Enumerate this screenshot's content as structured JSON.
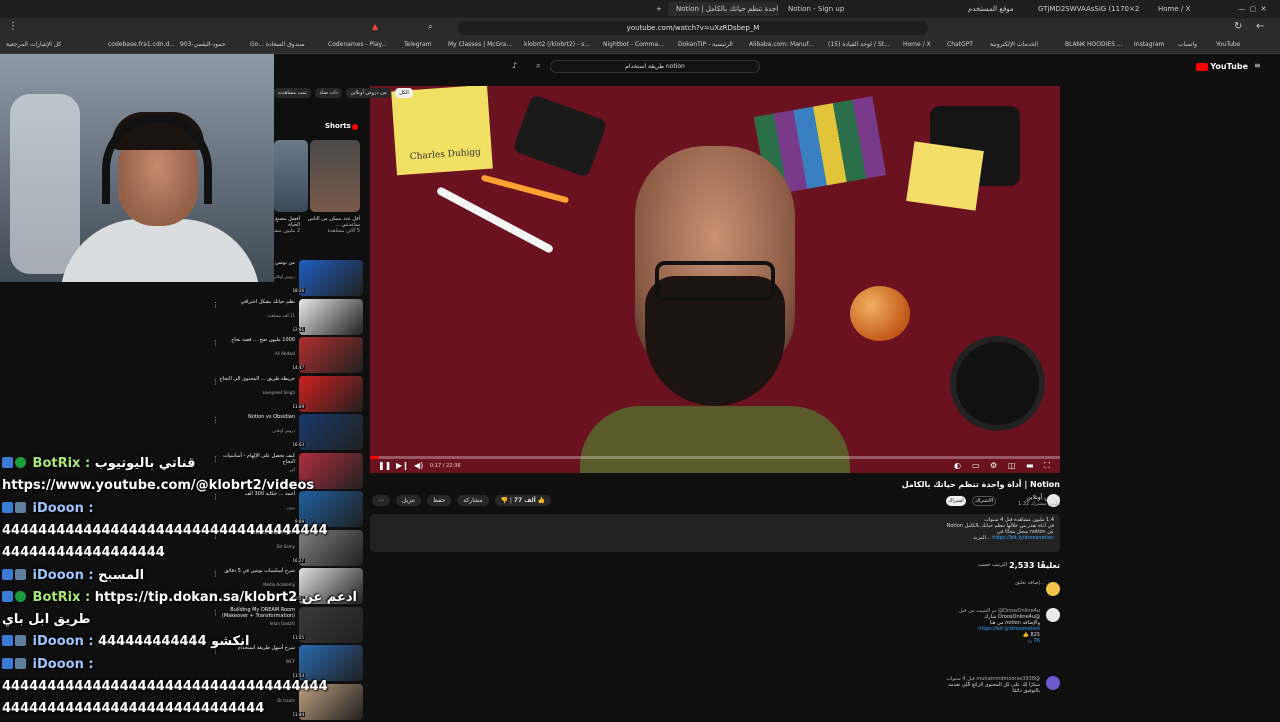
{
  "browser": {
    "tabs": [
      {
        "label": "GTjMD2SWVAAsSiG (1170×2532)"
      },
      {
        "label": "موقع المستخدم"
      },
      {
        "label": "Notion - Sign up"
      },
      {
        "label": "Notion | أداة واحدة تنظم حياتك بالكامل"
      },
      {
        "label": "Home / X"
      }
    ],
    "url": "youtube.com/watch?v=uXzRDsbep_M",
    "bookmarks": [
      {
        "label": "YouTube"
      },
      {
        "label": "واتساب"
      },
      {
        "label": "Instagram"
      },
      {
        "label": "BLANK HOODIES ..."
      },
      {
        "label": "الخدمات الإلكترونية"
      },
      {
        "label": "ChatGPT"
      },
      {
        "label": "Home / X"
      },
      {
        "label": "(15) لوحة القيادة / St..."
      },
      {
        "label": "Alibaba.com: Manuf..."
      },
      {
        "label": "DokanTIP - الرئيسية"
      },
      {
        "label": "Nightbot - Comma..."
      },
      {
        "label": "klobrt2 (/klobrt2) - s..."
      },
      {
        "label": "My Classes | McGra..."
      },
      {
        "label": "Telegram"
      },
      {
        "label": "Codenames - Play..."
      },
      {
        "label": "Go... صندوق السعادة"
      },
      {
        "label": "903-حمود-البقمي"
      },
      {
        "label": "codebase.fra1.cdn.d..."
      },
      {
        "label": "كل الإشارات المرجعية"
      }
    ]
  },
  "youtube": {
    "logo": "YouTube",
    "search_value": "طريقة استخدام notion",
    "video": {
      "sticky_text": "Charles Duhigg",
      "time": "0:17 / 22:36",
      "progress": 0.013,
      "title": "Notion | أداة واحدة تنظم حياتك بالكامل",
      "channel": "دروس أونلاين",
      "subs": "1.32 مليون مشترك",
      "subscribe": "اشتراك",
      "join": "الاشتراك",
      "likes": "77 ألف",
      "share": "مشاركة",
      "save": "حفظ",
      "clip": "تنزيل"
    },
    "description": {
      "stats": "1.4 مليون مشاهدة قبل 4 سنوات",
      "line1": "في أداة تقدر من خلالها تنظم حياتك بالكامل Notion",
      "line2": "عن notion سجل مجانًا في",
      "link": "https://bit.ly/droosnotion",
      "more": "...المزيد"
    },
    "comments": {
      "count": "2,533 تعليقًا",
      "sort": "الترتيب حسب",
      "add": "إضافة تعليق...",
      "items": [
        {
          "user": "DroosOnline4u@ تم التثبيت من قبل",
          "text": "@DroosOnline4u شارك",
          "extra": "والإضافة notion من هنا",
          "link": "https://bit.ly/droosnotion",
          "likes": "825",
          "replies": "76 رد"
        },
        {
          "user": "@muhammdmoorse3938 قبل 4 سنوات",
          "text": "شكرًا لك على كل المحتوى الرائع اللي تقدمه",
          "extra": "بالتوفيق دائمًا",
          "link": "",
          "likes": "",
          "replies": ""
        }
      ]
    },
    "chips": [
      {
        "label": "الكل"
      },
      {
        "label": "من دروس أونلاين"
      },
      {
        "label": "ذات صلة"
      },
      {
        "label": "تمت مشاهدته"
      }
    ],
    "shorts": {
      "title": "Shorts",
      "items": [
        {
          "title": "أقل عدد ممكن من الناس ساعدتني ...",
          "meta": "5 آلاف مشاهدة"
        },
        {
          "title": "أفضل مصنع ... الحياة",
          "meta": "2 مليون مشاهدة"
        }
      ]
    },
    "recs": [
      {
        "title": "من نوشن إلى إنستغرام",
        "meta": "دروس أونلاين",
        "dur": "18:26"
      },
      {
        "title": "نظم حياتك بشكل احترافي",
        "meta": "11 ألف مشاهدة",
        "dur": "12:01"
      },
      {
        "title": "1000 مليون صح ... قصة نجاح",
        "meta": "Ali Abdaal",
        "dur": "14:47"
      },
      {
        "title": "خريطة طريق ... المحتوى الى النجاح",
        "meta": "Lovepreet Singh",
        "dur": "11:09"
      },
      {
        "title": "Notion vs Obsidian",
        "meta": "دروس أونلاين",
        "dur": "16:03"
      },
      {
        "title": "كيف تحصل على الإلهام - أساسيات النجاح",
        "meta": "أثير",
        "dur": "12:25"
      },
      {
        "title": "أحمد ... حكاية 300 ألف",
        "meta": "بدون",
        "dur": "8:09"
      },
      {
        "title": "أخيرًا النسخة الكاملة",
        "meta": "Bri Samy",
        "dur": "16:27"
      },
      {
        "title": "شرح أساسيات نوشن في 5 دقائق",
        "meta": "Media Academy",
        "dur": "10:58"
      },
      {
        "title": "Building My DREAM Room (Makeover + Transformation)",
        "meta": "Iman Gadzhi",
        "dur": "11:55"
      },
      {
        "title": "شرح أسهل طريقة استخدام",
        "meta": "WCF",
        "dur": "11:54"
      },
      {
        "title": "فكك مجاني",
        "meta": "Dr Issam",
        "dur": "11:44"
      }
    ]
  },
  "chat": {
    "lines": [
      {
        "kind": "bot",
        "name": "BotRix :",
        "text": "قناتي باليوتيوب"
      },
      {
        "kind": "plain",
        "name": "",
        "text": "https://www.youtube.com/@klobrt2/videos"
      },
      {
        "kind": "user",
        "name": "iDooon :",
        "text": ""
      },
      {
        "kind": "plain",
        "name": "",
        "text": "444444444444444444444444444444444444"
      },
      {
        "kind": "plain",
        "name": "",
        "text": "444444444444444444"
      },
      {
        "kind": "user",
        "name": "iDooon :",
        "text": "المسبح"
      },
      {
        "kind": "bot",
        "name": "BotRix :",
        "text": "https://tip.dokan.sa/klobrt2 ادعم عن"
      },
      {
        "kind": "plain",
        "name": "",
        "text": "طريق ابل باي"
      },
      {
        "kind": "user",
        "name": "iDooon :",
        "text": "444444444444 انكشو"
      },
      {
        "kind": "user",
        "name": "iDooon :",
        "text": ""
      },
      {
        "kind": "plain",
        "name": "",
        "text": "444444444444444444444444444444444444"
      },
      {
        "kind": "plain",
        "name": "",
        "text": "44444444444444444444444444444"
      }
    ]
  },
  "colors": {
    "accent": "#ff0000",
    "link": "#3ea6ff",
    "bot_name": "#a8e67a",
    "user_name": "#9ec5ff"
  }
}
